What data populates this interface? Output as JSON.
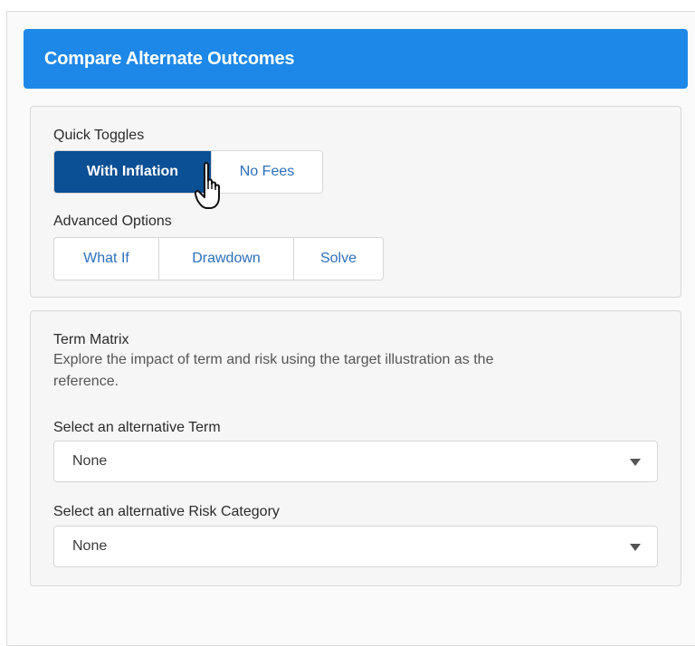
{
  "header": {
    "title": "Compare Alternate Outcomes",
    "color": "#1e88e8"
  },
  "quick_toggles": {
    "label": "Quick Toggles",
    "buttons": [
      {
        "label": "With Inflation",
        "active": true
      },
      {
        "label": "No Fees",
        "active": false
      }
    ]
  },
  "advanced_options": {
    "label": "Advanced Options",
    "buttons": [
      {
        "label": "What If"
      },
      {
        "label": "Drawdown"
      },
      {
        "label": "Solve"
      }
    ]
  },
  "term_matrix": {
    "title": "Term Matrix",
    "description_line1": "Explore the impact of term and risk using the target illustration as the",
    "description_line2": "reference.",
    "term_select": {
      "label": "Select an alternative Term",
      "value": "None"
    },
    "risk_select": {
      "label": "Select an alternative Risk Category",
      "value": "None"
    }
  },
  "icons": {
    "cursor": "hand-pointer-icon",
    "dropdown": "chevron-down-icon"
  },
  "colors": {
    "active_button": "#0b4f94",
    "link_text": "#2d6fba"
  }
}
